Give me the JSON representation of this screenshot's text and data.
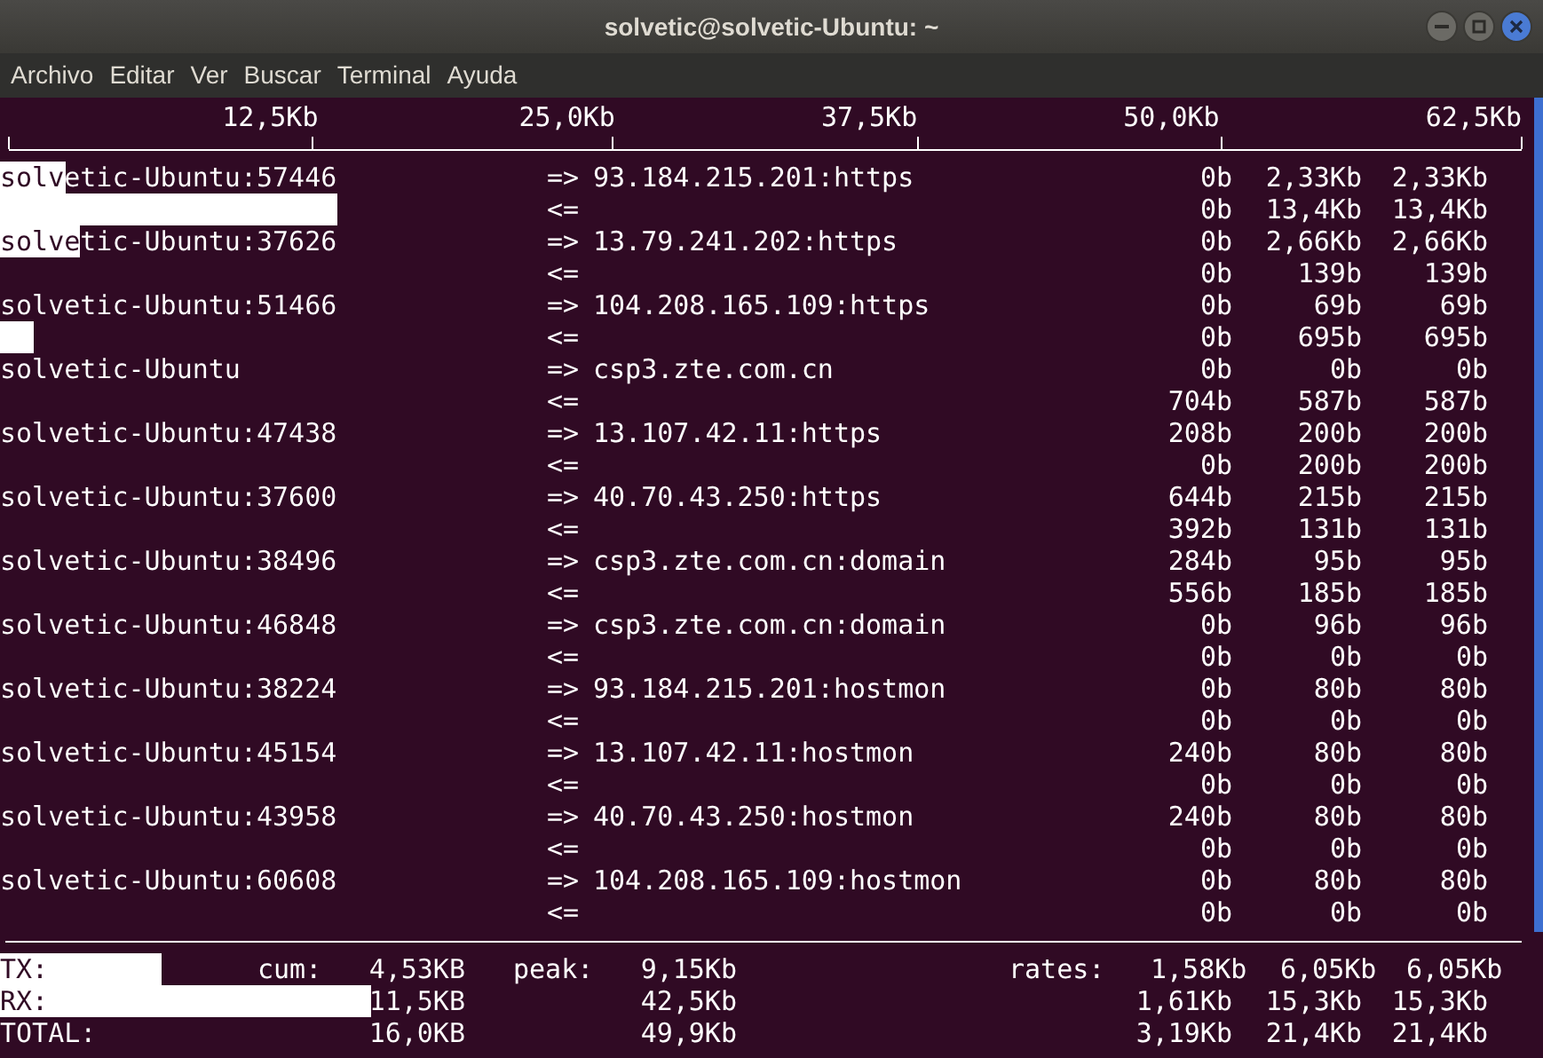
{
  "window": {
    "title": "solvetic@solvetic-Ubuntu: ~"
  },
  "menu": [
    "Archivo",
    "Editar",
    "Ver",
    "Buscar",
    "Terminal",
    "Ayuda"
  ],
  "scale": [
    "12,5Kb",
    "25,0Kb",
    "37,5Kb",
    "50,0Kb",
    "62,5Kb"
  ],
  "connections": [
    {
      "host": "solvetic-Ubuntu:57446",
      "out": {
        "arrow": "=>",
        "dest": "93.184.215.201:https",
        "values": [
          "0b",
          "2,33Kb",
          "2,33Kb"
        ],
        "level": 0.043
      },
      "in": {
        "arrow": "<=",
        "values": [
          "0b",
          "13,4Kb",
          "13,4Kb"
        ],
        "level": 0.219
      }
    },
    {
      "host": "solvetic-Ubuntu:37626",
      "out": {
        "arrow": "=>",
        "dest": "13.79.241.202:https",
        "values": [
          "0b",
          "2,66Kb",
          "2,66Kb"
        ],
        "level": 0.052
      },
      "in": {
        "arrow": "<=",
        "values": [
          "0b",
          "139b",
          "139b"
        ]
      }
    },
    {
      "host": "solvetic-Ubuntu:51466",
      "out": {
        "arrow": "=>",
        "dest": "104.208.165.109:https",
        "values": [
          "0b",
          "69b",
          "69b"
        ]
      },
      "in": {
        "arrow": "<=",
        "values": [
          "0b",
          "695b",
          "695b"
        ],
        "level": 0.022
      }
    },
    {
      "host": "solvetic-Ubuntu",
      "out": {
        "arrow": "=>",
        "dest": "csp3.zte.com.cn",
        "values": [
          "0b",
          "0b",
          "0b"
        ]
      },
      "in": {
        "arrow": "<=",
        "values": [
          "704b",
          "587b",
          "587b"
        ]
      }
    },
    {
      "host": "solvetic-Ubuntu:47438",
      "out": {
        "arrow": "=>",
        "dest": "13.107.42.11:https",
        "values": [
          "208b",
          "200b",
          "200b"
        ]
      },
      "in": {
        "arrow": "<=",
        "values": [
          "0b",
          "200b",
          "200b"
        ]
      }
    },
    {
      "host": "solvetic-Ubuntu:37600",
      "out": {
        "arrow": "=>",
        "dest": "40.70.43.250:https",
        "values": [
          "644b",
          "215b",
          "215b"
        ]
      },
      "in": {
        "arrow": "<=",
        "values": [
          "392b",
          "131b",
          "131b"
        ]
      }
    },
    {
      "host": "solvetic-Ubuntu:38496",
      "out": {
        "arrow": "=>",
        "dest": "csp3.zte.com.cn:domain",
        "values": [
          "284b",
          "95b",
          "95b"
        ]
      },
      "in": {
        "arrow": "<=",
        "values": [
          "556b",
          "185b",
          "185b"
        ]
      }
    },
    {
      "host": "solvetic-Ubuntu:46848",
      "out": {
        "arrow": "=>",
        "dest": "csp3.zte.com.cn:domain",
        "values": [
          "0b",
          "96b",
          "96b"
        ]
      },
      "in": {
        "arrow": "<=",
        "values": [
          "0b",
          "0b",
          "0b"
        ]
      }
    },
    {
      "host": "solvetic-Ubuntu:38224",
      "out": {
        "arrow": "=>",
        "dest": "93.184.215.201:hostmon",
        "values": [
          "0b",
          "80b",
          "80b"
        ]
      },
      "in": {
        "arrow": "<=",
        "values": [
          "0b",
          "0b",
          "0b"
        ]
      }
    },
    {
      "host": "solvetic-Ubuntu:45154",
      "out": {
        "arrow": "=>",
        "dest": "13.107.42.11:hostmon",
        "values": [
          "240b",
          "80b",
          "80b"
        ]
      },
      "in": {
        "arrow": "<=",
        "values": [
          "0b",
          "0b",
          "0b"
        ]
      }
    },
    {
      "host": "solvetic-Ubuntu:43958",
      "out": {
        "arrow": "=>",
        "dest": "40.70.43.250:hostmon",
        "values": [
          "240b",
          "80b",
          "80b"
        ]
      },
      "in": {
        "arrow": "<=",
        "values": [
          "0b",
          "0b",
          "0b"
        ]
      }
    },
    {
      "host": "solvetic-Ubuntu:60608",
      "out": {
        "arrow": "=>",
        "dest": "104.208.165.109:hostmon",
        "values": [
          "0b",
          "80b",
          "80b"
        ]
      },
      "in": {
        "arrow": "<=",
        "values": [
          "0b",
          "0b",
          "0b"
        ]
      }
    }
  ],
  "totals": [
    {
      "label": "TX:",
      "cum_label": "cum:",
      "cum": "4,53KB",
      "peak_label": "peak:",
      "peak": "9,15Kb",
      "rates_label": "rates:",
      "rates": [
        "1,58Kb",
        "6,05Kb",
        "6,05Kb"
      ],
      "level": 0.105
    },
    {
      "label": "RX:",
      "cum": "11,5KB",
      "peak": "42,5Kb",
      "rates": [
        "1,61Kb",
        "15,3Kb",
        "15,3Kb"
      ],
      "level": 0.24
    },
    {
      "label": "TOTAL:",
      "cum": "16,0KB",
      "peak": "49,9Kb",
      "rates": [
        "3,19Kb",
        "21,4Kb",
        "21,4Kb"
      ]
    }
  ]
}
